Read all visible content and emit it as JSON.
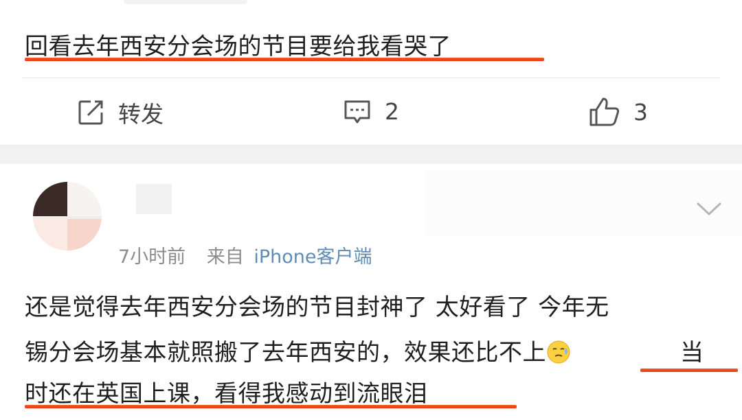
{
  "top_post": {
    "text": "回看去年西安分会场的节目要给我看哭了",
    "actions": {
      "repost_label": "转发",
      "comment_count": "2",
      "like_count": "3"
    }
  },
  "comment": {
    "meta": {
      "time": "7小时前",
      "source_prefix": "来自",
      "source": "iPhone客户端"
    },
    "lines": [
      "还是觉得去年西安分会场的节目封神了 太好看了 今年无",
      "锡分会场基本就照搬了去年西安的，效果还比不上",
      "当",
      "时还在英国上课，看得我感动到流眼泪"
    ],
    "emoji_name": "sweat-emoji"
  },
  "colors": {
    "highlight_underline": "#e8461c",
    "icon_gray": "#555555",
    "meta_gray": "#8c8c8c"
  }
}
